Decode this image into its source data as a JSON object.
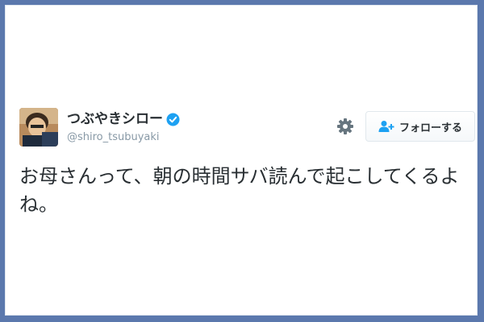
{
  "user": {
    "display_name": "つぶやきシロー",
    "handle": "@shiro_tsubuyaki",
    "verified": true
  },
  "actions": {
    "follow_label": "フォローする",
    "follow_icon": "person-add-icon",
    "settings_icon": "gear-icon"
  },
  "tweet": {
    "text": "お母さんって、朝の時間サバ読んで起こしてくるよね。"
  },
  "colors": {
    "frame": "#5b78ad",
    "verified_badge": "#1da1f2",
    "follow_icon": "#1da1f2",
    "text": "#292f33",
    "muted": "#8899a6"
  }
}
